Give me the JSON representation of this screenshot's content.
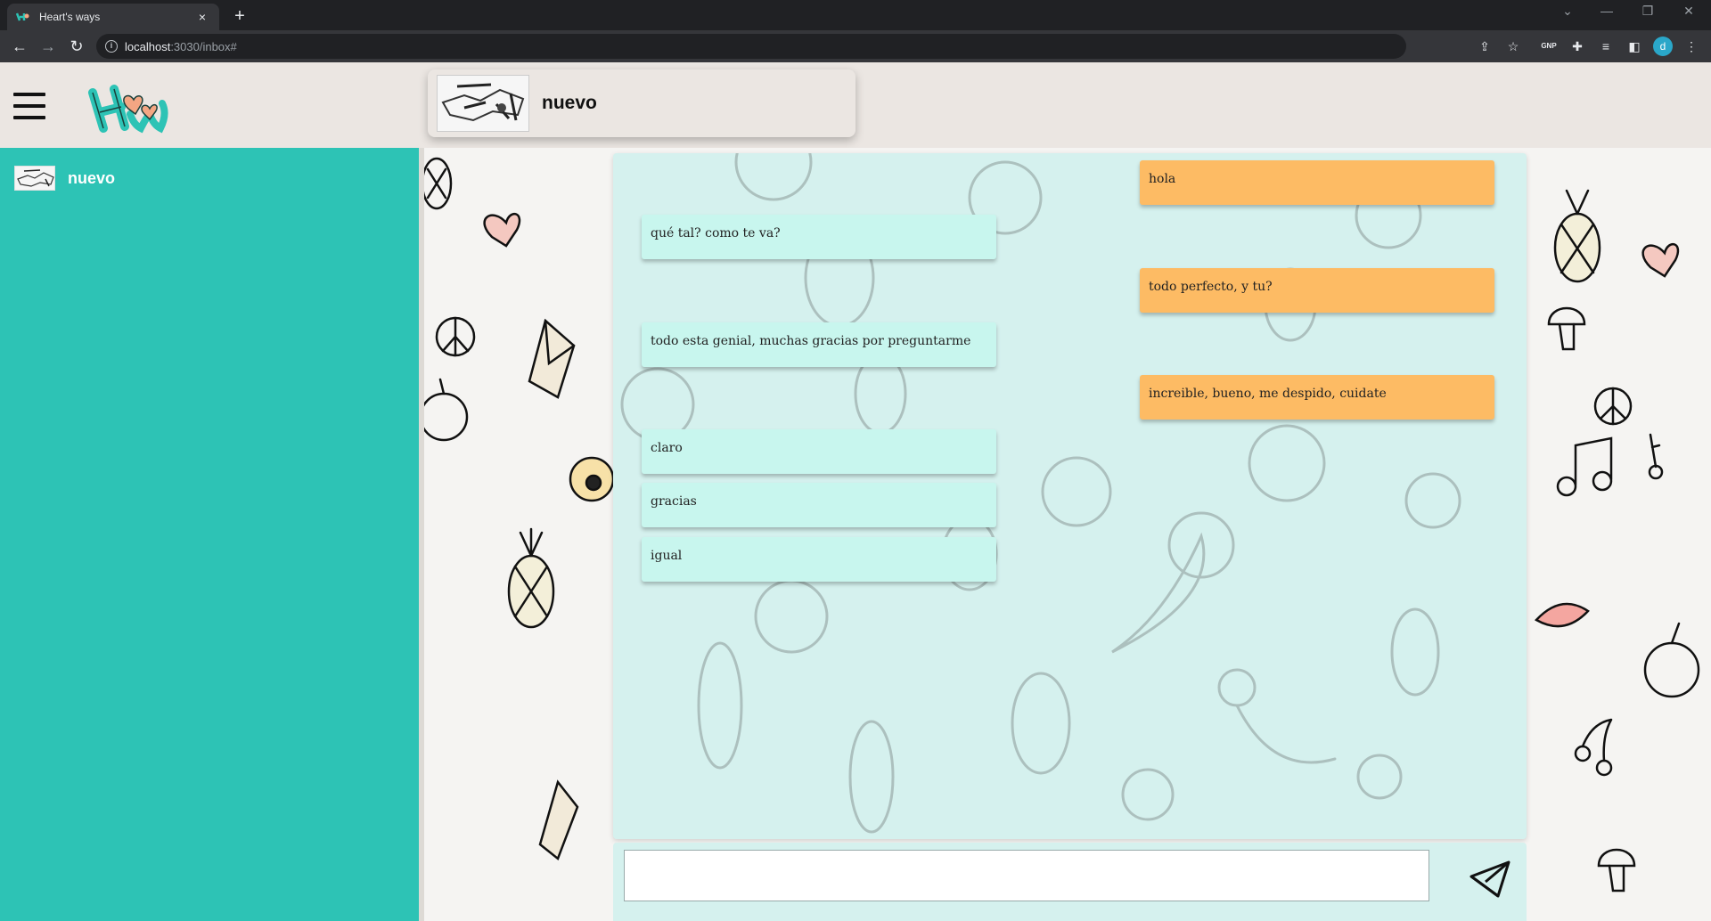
{
  "browser": {
    "tab_title": "Heart's ways",
    "tab_close": "×",
    "new_tab": "+",
    "url_host": "localhost",
    "url_path": ":3030/inbox#",
    "profile_initial": "d",
    "ext_label": "GNP"
  },
  "chat": {
    "contact_name": "nuevo",
    "messages": [
      {
        "side": "sent",
        "text": "hola"
      },
      {
        "side": "recv",
        "text": "qué tal? como te va?"
      },
      {
        "side": "sent",
        "text": "todo perfecto, y tu?"
      },
      {
        "side": "recv",
        "text": "todo esta genial, muchas gracias por preguntarme"
      },
      {
        "side": "sent",
        "text": "increible, bueno, me despido, cuidate"
      },
      {
        "side": "recv",
        "text": "claro"
      },
      {
        "side": "recv",
        "text": "gracias"
      },
      {
        "side": "recv",
        "text": "igual"
      }
    ],
    "input_value": ""
  },
  "sidebar": {
    "contacts": [
      {
        "name": "nuevo"
      }
    ]
  },
  "colors": {
    "sidebar": "#2dc3b5",
    "header": "#ebe6e2",
    "sent_bubble": "#fdbb64",
    "recv_bubble": "#c8f6ee",
    "panel": "#d5f1ee"
  },
  "icons": {
    "menu": "hamburger-menu-icon",
    "send": "paper-plane-send-icon",
    "back": "back-arrow-icon",
    "forward": "forward-arrow-icon",
    "reload": "reload-icon"
  }
}
